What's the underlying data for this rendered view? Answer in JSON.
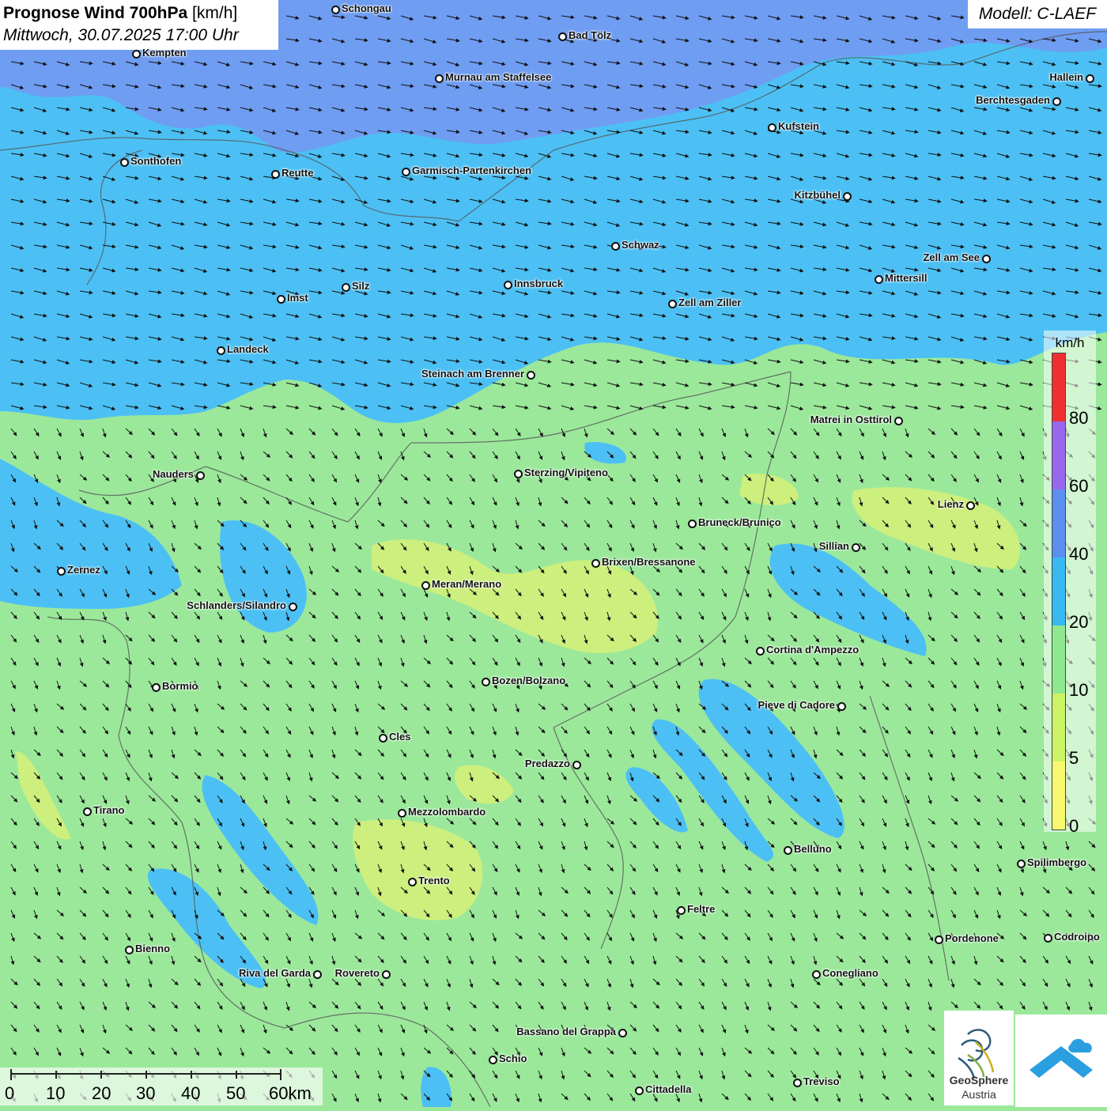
{
  "title": {
    "main": "Prognose Wind 700hPa",
    "unit": "[km/h]",
    "datetime": "Mittwoch, 30.07.2025 17:00 Uhr"
  },
  "model": "Modell: C-LAEF",
  "legend": {
    "unit": "km/h",
    "ticks": [
      "80",
      "60",
      "40",
      "20",
      "10",
      "5",
      "0"
    ],
    "colors": [
      "#f03030",
      "#9966ee",
      "#5b8ff0",
      "#38b8f0",
      "#8ee88e",
      "#ccf266",
      "#f8f870"
    ]
  },
  "scale": {
    "labels": [
      "0",
      "10",
      "20",
      "30",
      "40",
      "50",
      "60km"
    ]
  },
  "logos": {
    "geosphere_line1": "GeoSphere",
    "geosphere_line2": "Austria"
  },
  "cities": [
    "Schongau",
    "Bad Tölz",
    "Kempten",
    "Murnau am Staffelsee",
    "Hallein",
    "Berchtesgaden",
    "Kufstein",
    "Sonthofen",
    "Reutte",
    "Garmisch-Partenkirchen",
    "Kitzbühel",
    "Schwaz",
    "Zell am See",
    "Mittersill",
    "Silz",
    "Innsbruck",
    "Imst",
    "Zell am Ziller",
    "Landeck",
    "Steinach am Brenner",
    "Matrei in Osttirol",
    "Nauders",
    "Sterzing/Vipiteno",
    "Lienz",
    "Bruneck/Brunico",
    "Sillian",
    "Brixen/Bressanone",
    "Zernez",
    "Meran/Merano",
    "Schlanders/Silandro",
    "Cortina d'Ampezzo",
    "Bozen/Bolzano",
    "Bormio",
    "Pieve di Cadore",
    "Cles",
    "Predazzo",
    "Tirano",
    "Mezzolombardo",
    "Belluno",
    "Spilimbergo",
    "Trento",
    "Feltre",
    "Bienno",
    "Pordenone",
    "Codroipo",
    "Riva del Garda",
    "Rovereto",
    "Conegliano",
    "Bassano del Grappa",
    "Schio",
    "Treviso",
    "Cittadella"
  ]
}
